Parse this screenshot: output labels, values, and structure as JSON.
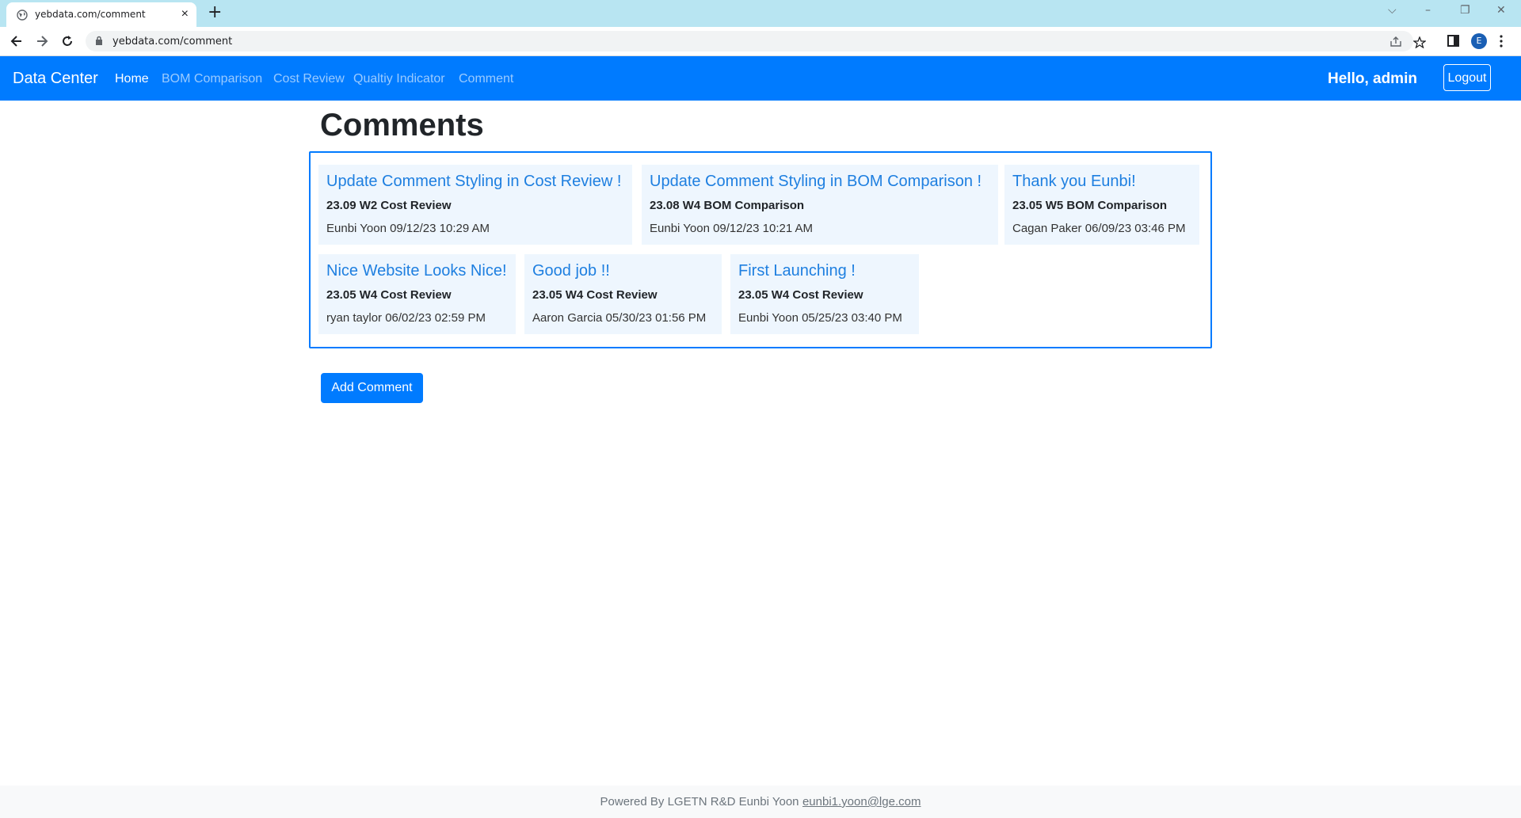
{
  "browser": {
    "tab_title": "yebdata.com/comment",
    "tab_close": "×",
    "new_tab": "+",
    "url": "yebdata.com/comment",
    "profile_initial": "E",
    "window_controls": {
      "dropdown": "⌵",
      "minimize": "–",
      "restore": "❐",
      "close": "✕"
    }
  },
  "navbar": {
    "brand": "Data Center",
    "links": [
      {
        "label": "Home",
        "active": true
      },
      {
        "label": "BOM Comparison",
        "active": false
      },
      {
        "label": "Cost Review",
        "active": false
      },
      {
        "label": "Qualtiy Indicator",
        "active": false
      },
      {
        "label": "Comment",
        "active": false
      }
    ],
    "greeting": "Hello, admin",
    "logout": "Logout"
  },
  "main": {
    "title": "Comments",
    "comments": [
      {
        "title": "Update Comment Styling in Cost Review !",
        "subject": "23.09 W2 Cost Review",
        "meta": "Eunbi Yoon 09/12/23 10:29 AM"
      },
      {
        "title": "Update Comment Styling in BOM Comparison !",
        "subject": "23.08 W4 BOM Comparison",
        "meta": "Eunbi Yoon 09/12/23 10:21 AM"
      },
      {
        "title": "Thank you Eunbi!",
        "subject": "23.05 W5 BOM Comparison",
        "meta": "Cagan Paker 06/09/23 03:46 PM"
      },
      {
        "title": "Nice Website Looks Nice!",
        "subject": "23.05 W4 Cost Review",
        "meta": "ryan taylor 06/02/23 02:59 PM"
      },
      {
        "title": "Good job !!",
        "subject": "23.05 W4 Cost Review",
        "meta": "Aaron Garcia 05/30/23 01:56 PM"
      },
      {
        "title": "First Launching !",
        "subject": "23.05 W4 Cost Review",
        "meta": "Eunbi Yoon 05/25/23 03:40 PM"
      }
    ],
    "add_button": "Add Comment"
  },
  "footer": {
    "text": "Powered By LGETN R&D Eunbi Yoon",
    "email": "eunbi1.yoon@lge.com"
  },
  "colors": {
    "primary": "#007bff",
    "card_bg": "#eef6fe",
    "card_title": "#1e7fe0",
    "tabbar": "#b8e5f2"
  }
}
